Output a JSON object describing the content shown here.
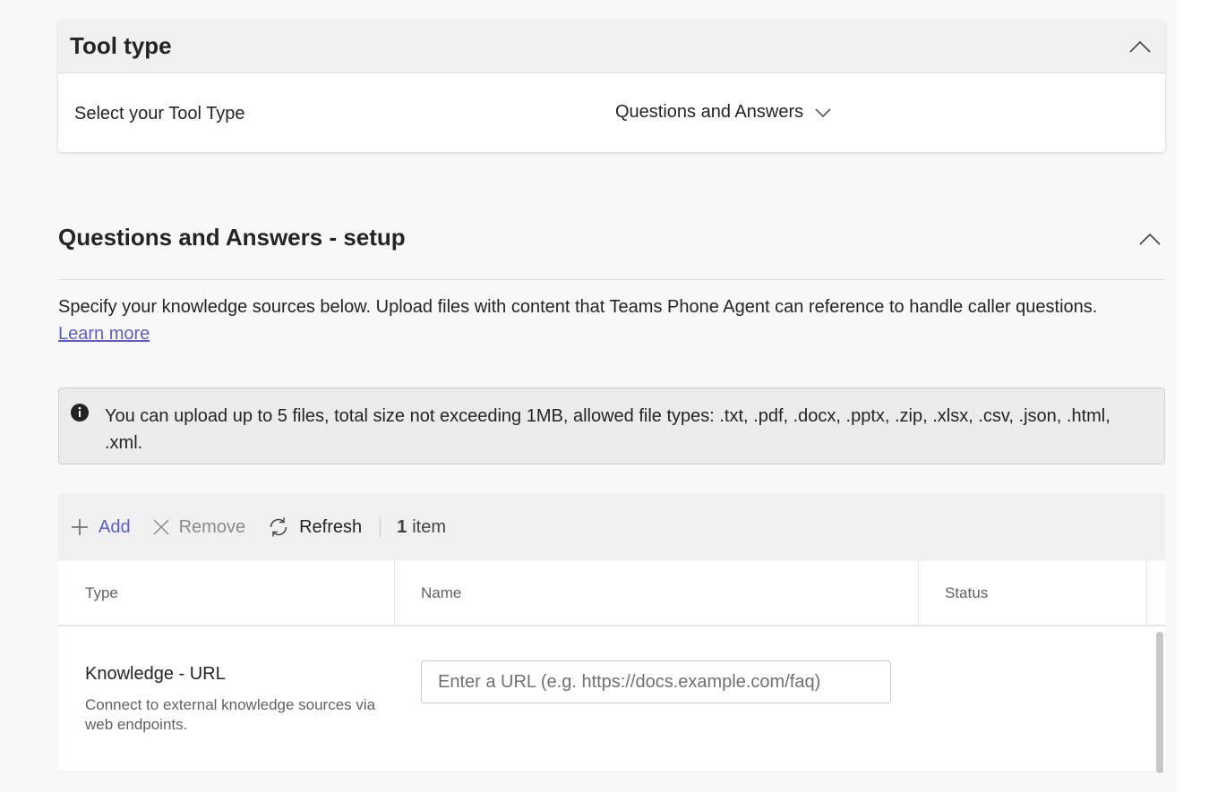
{
  "tool_type": {
    "title": "Tool type",
    "label": "Select your Tool Type",
    "selected_value": "Questions and Answers",
    "collapse_icon": "chevron-up-icon",
    "dropdown_icon": "chevron-down-icon"
  },
  "qa_setup": {
    "title": "Questions and Answers - setup",
    "description": "Specify your knowledge sources below. Upload files with content that Teams Phone Agent can reference to handle caller questions.",
    "learn_more": "Learn more",
    "info": "You can upload up to 5 files, total size not exceeding 1MB, allowed file types: .txt, .pdf, .docx, .pptx, .zip, .xlsx, .csv, .json, .html, .xml."
  },
  "toolbar": {
    "add": "Add",
    "remove": "Remove",
    "refresh": "Refresh",
    "count": "1",
    "count_label": "item"
  },
  "table": {
    "columns": [
      "Type",
      "Name",
      "Status"
    ],
    "rows": [
      {
        "type_title": "Knowledge - URL",
        "type_desc": "Connect to external knowledge sources via web endpoints.",
        "name_placeholder": "Enter a URL (e.g. https://docs.example.com/faq)",
        "status": ""
      }
    ]
  },
  "colors": {
    "accent": "#5b5fc7",
    "background": "#f8f8f8",
    "text": "#242424"
  }
}
